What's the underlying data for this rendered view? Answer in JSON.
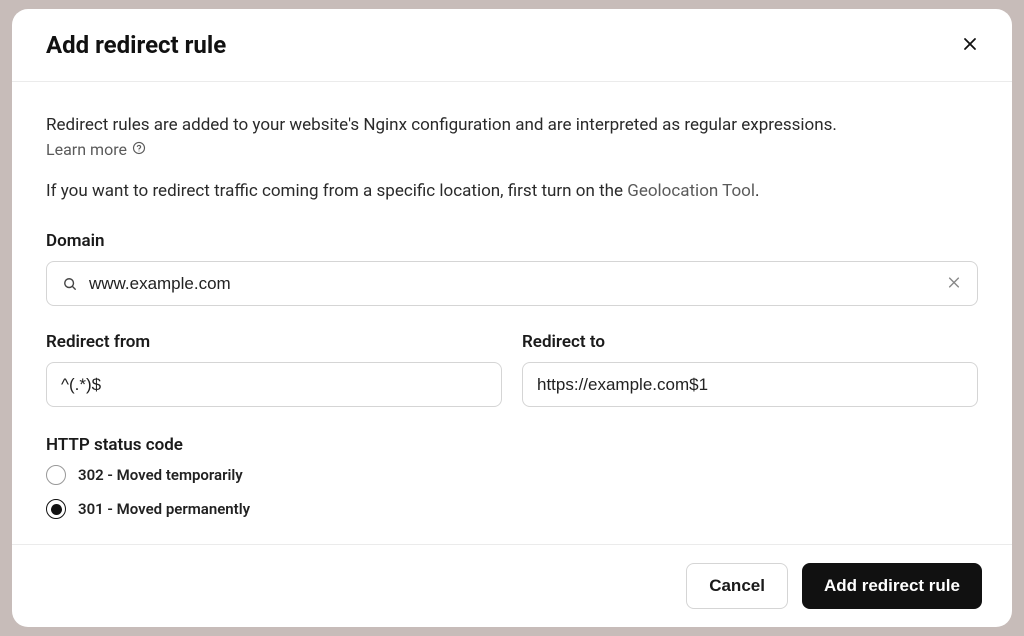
{
  "modal": {
    "title": "Add redirect rule",
    "description": "Redirect rules are added to your website's Nginx configuration and are interpreted as regular expressions.",
    "learn_more_label": "Learn more",
    "geo_prefix": "If you want to redirect traffic coming from a specific location, first turn on the ",
    "geo_link": "Geolocation Tool",
    "geo_suffix": "."
  },
  "form": {
    "domain_label": "Domain",
    "domain_value": "www.example.com",
    "redirect_from_label": "Redirect from",
    "redirect_from_value": "^(.*)$",
    "redirect_to_label": "Redirect to",
    "redirect_to_value": "https://example.com$1",
    "status_code_label": "HTTP status code",
    "status_options": [
      {
        "label": "302 - Moved temporarily",
        "selected": false
      },
      {
        "label": "301 - Moved permanently",
        "selected": true
      }
    ]
  },
  "footer": {
    "cancel_label": "Cancel",
    "submit_label": "Add redirect rule"
  }
}
